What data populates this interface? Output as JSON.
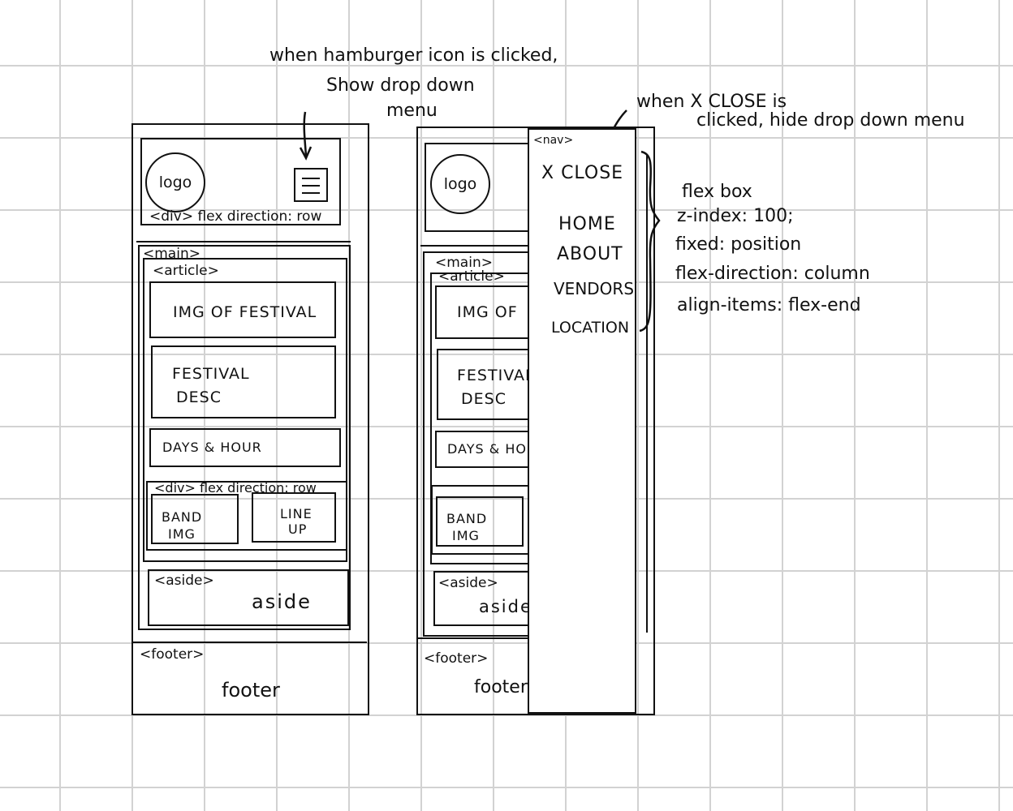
{
  "annotations": {
    "hamburger_note_line1": "when hamburger icon is clicked,",
    "hamburger_note_line2": "Show drop down",
    "hamburger_note_line3": "menu",
    "close_note_line1": "when X CLOSE is",
    "close_note_line2": "clicked, hide drop down menu",
    "nav_css": [
      "flex box",
      "z-index: 100;",
      "fixed: position",
      "flex-direction: column",
      "align-items: flex-end"
    ]
  },
  "left_wireframe": {
    "logo": "logo",
    "header_tag": "<div> flex direction: row",
    "main_tag": "<main>",
    "article_tag": "<article>",
    "img_festival": "IMG OF FESTIVAL",
    "festival_desc_line1": "FESTIVAL",
    "festival_desc_line2": "DESC",
    "days_hour": "DAYS & HOUR",
    "row_tag": "<div> flex direction: row",
    "band_img_line1": "BAND",
    "band_img_line2": "IMG",
    "lineup_line1": "LINE",
    "lineup_line2": "UP",
    "aside_tag": "<aside>",
    "aside_label": "aside",
    "footer_tag": "<footer>",
    "footer_label": "footer"
  },
  "right_wireframe": {
    "logo": "logo",
    "main_tag": "<main>",
    "article_tag": "<article>",
    "img_festival": "IMG OF",
    "festival_desc_line1": "FESTIVAL",
    "festival_desc_line2": "DESC",
    "days_hour": "DAYS & HO",
    "band_img_line1": "BAND",
    "band_img_line2": "IMG",
    "aside_tag": "<aside>",
    "aside_label": "aside",
    "footer_tag": "<footer>",
    "footer_label": "footer",
    "nav_tag": "<nav>",
    "nav_items": [
      "X CLOSE",
      "HOME",
      "ABOUT",
      "VENDORS",
      "LOCATION"
    ]
  }
}
